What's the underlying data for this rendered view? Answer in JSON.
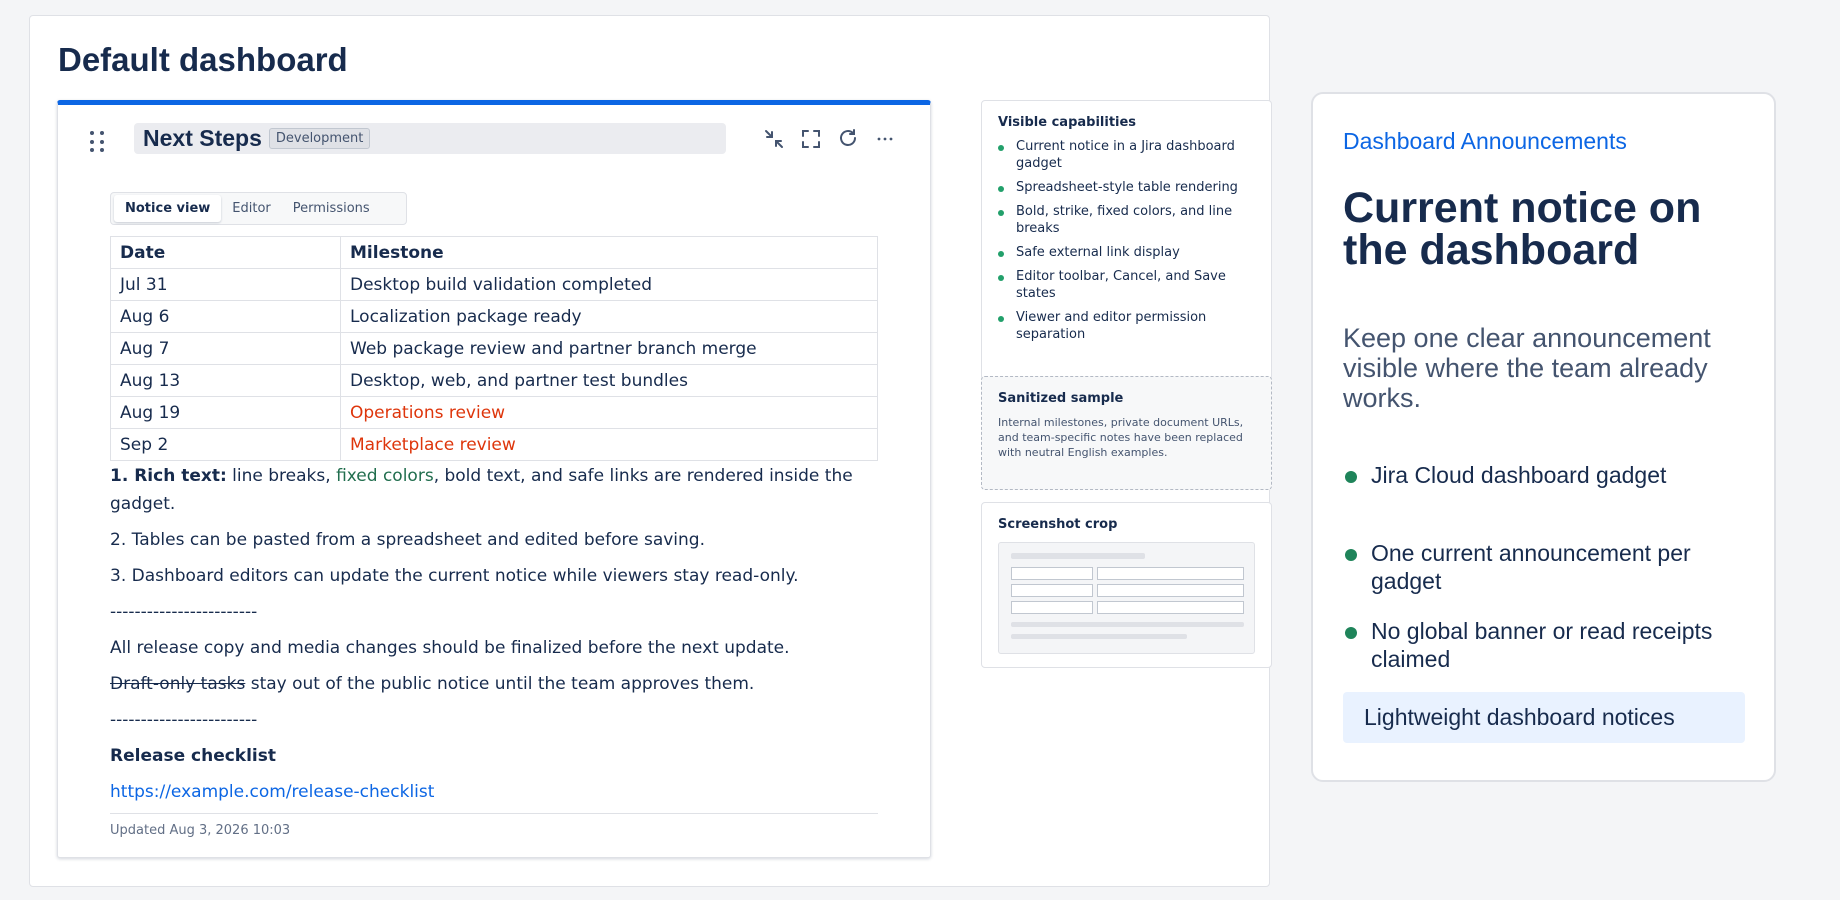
{
  "page": {
    "title": "Default dashboard"
  },
  "gadget": {
    "title": "Next Steps",
    "lozenge": "Development",
    "actions": [
      "minimize-icon",
      "fullscreen-icon",
      "refresh-icon",
      "more-icon"
    ],
    "tabs": [
      {
        "label": "Notice view",
        "active": true
      },
      {
        "label": "Editor",
        "active": false
      },
      {
        "label": "Permissions",
        "active": false
      }
    ],
    "table": {
      "headers": [
        "Date",
        "Milestone"
      ],
      "rows": [
        {
          "date": "Jul 31",
          "milestone": "Desktop build validation completed",
          "highlight": false
        },
        {
          "date": "Aug 6",
          "milestone": "Localization package ready",
          "highlight": false
        },
        {
          "date": "Aug 7",
          "milestone": "Web package review and partner branch merge",
          "highlight": false
        },
        {
          "date": "Aug 13",
          "milestone": "Desktop, web, and partner test bundles",
          "highlight": false
        },
        {
          "date": "Aug 19",
          "milestone": "Operations review",
          "highlight": true
        },
        {
          "date": "Sep 2",
          "milestone": "Marketplace review",
          "highlight": true
        }
      ]
    },
    "notes": {
      "n1_bold": "1. Rich text:",
      "n1_a": " line breaks, ",
      "n1_green": "fixed colors",
      "n1_b": ", bold text, and safe links are rendered inside the gadget.",
      "n2": "2. Tables can be pasted from a spreadsheet and edited before saving.",
      "n3": "3. Dashboard editors can update the current notice while viewers stay read-only.",
      "rule": "------------------------",
      "p1": "All release copy and media changes should be finalized before the next update.",
      "strike": "Draft-only tasks",
      "p2_rest": " stay out of the public notice until the team approves them.",
      "checklist_title": "Release checklist",
      "checklist_link": "https://example.com/release-checklist"
    },
    "updated": "Updated Aug 3, 2026 10:03"
  },
  "side": {
    "capabilities_title": "Visible capabilities",
    "capabilities": [
      "Current notice in a Jira dashboard gadget",
      "Spreadsheet-style table rendering",
      "Bold, strike, fixed colors, and line breaks",
      "Safe external link display",
      "Editor toolbar, Cancel, and Save states",
      "Viewer and editor permission separation"
    ],
    "sample_title": "Sanitized sample",
    "sample_text": "Internal milestones, private document URLs, and team-specific notes have been replaced with neutral English examples.",
    "crop_title": "Screenshot crop"
  },
  "promo": {
    "kicker": "Dashboard Announcements",
    "title": "Current notice on the dashboard",
    "subtitle": "Keep one clear announcement visible where the team already works.",
    "bullets": [
      "Jira Cloud dashboard gadget",
      "One current announcement per gadget",
      "No global banner or read receipts claimed"
    ],
    "chip": "Lightweight dashboard notices"
  },
  "colors": {
    "accent": "#0c66e4",
    "text": "#172b4d",
    "red_text": "#de350b",
    "green_text": "#216e4e",
    "bullet_green": "#1f845a"
  }
}
